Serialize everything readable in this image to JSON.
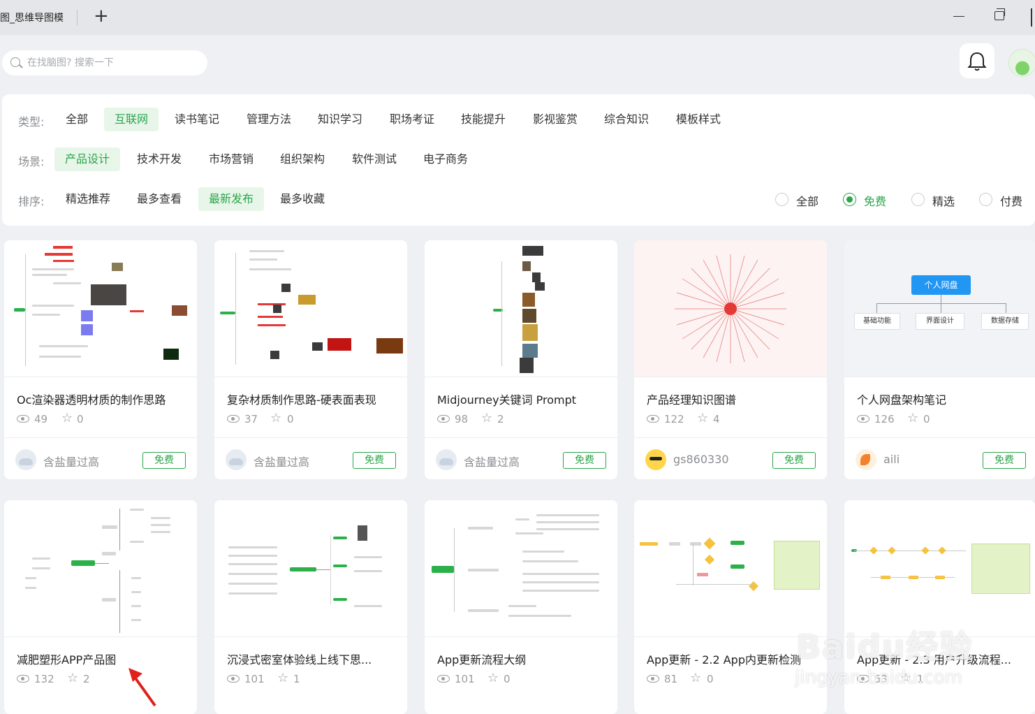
{
  "titlebar": {
    "tab_title": "图_思维导图模",
    "new_tab": "+"
  },
  "search": {
    "placeholder": "在找脑图? 搜索一下"
  },
  "filters": {
    "type_label": "类型:",
    "type_items": [
      "全部",
      "互联网",
      "读书笔记",
      "管理方法",
      "知识学习",
      "职场考证",
      "技能提升",
      "影视鉴赏",
      "综合知识",
      "模板样式"
    ],
    "type_active": "互联网",
    "scene_label": "场景:",
    "scene_items": [
      "产品设计",
      "技术开发",
      "市场营销",
      "组织架构",
      "软件测试",
      "电子商务"
    ],
    "scene_active": "产品设计",
    "sort_label": "排序:",
    "sort_items": [
      "精选推荐",
      "最多查看",
      "最新发布",
      "最多收藏"
    ],
    "sort_active": "最新发布",
    "price_options": [
      "全部",
      "免费",
      "精选",
      "付费"
    ],
    "price_selected": "免费"
  },
  "colors": {
    "accent": "#2aa54a",
    "accent_bg": "#e8f6ea"
  },
  "cards": [
    {
      "title": "Oc渲染器透明材质的制作思路",
      "views": "49",
      "stars": "0",
      "author": "含盐量过高",
      "badge": "免费"
    },
    {
      "title": "复杂材质制作思路-硬表面表现",
      "views": "37",
      "stars": "0",
      "author": "含盐量过高",
      "badge": "免费"
    },
    {
      "title": "Midjourney关键词 Prompt",
      "views": "98",
      "stars": "2",
      "author": "含盐量过高",
      "badge": "免费"
    },
    {
      "title": "产品经理知识图谱",
      "views": "122",
      "stars": "4",
      "author": "gs860330",
      "badge": "免费"
    },
    {
      "title": "个人网盘架构笔记",
      "views": "126",
      "stars": "0",
      "author": "aili",
      "badge": "免费"
    },
    {
      "title": "减肥塑形APP产品图",
      "views": "132",
      "stars": "2"
    },
    {
      "title": "沉浸式密室体验线上线下思...",
      "views": "101",
      "stars": "1"
    },
    {
      "title": "App更新流程大纲",
      "views": "101",
      "stars": "0"
    },
    {
      "title": "App更新 - 2.2 App内更新检测",
      "views": "81",
      "stars": "0"
    },
    {
      "title": "App更新 - 2.3 用户升级流程...",
      "views": "53",
      "stars": "1"
    }
  ],
  "thumb_text": {
    "card5_root": "个人网盘",
    "card5_children": [
      "基础功能",
      "界面设计",
      "数据存储"
    ]
  },
  "watermark": {
    "main": "Baidu经验",
    "sub": "jingyan.baidu.com"
  }
}
